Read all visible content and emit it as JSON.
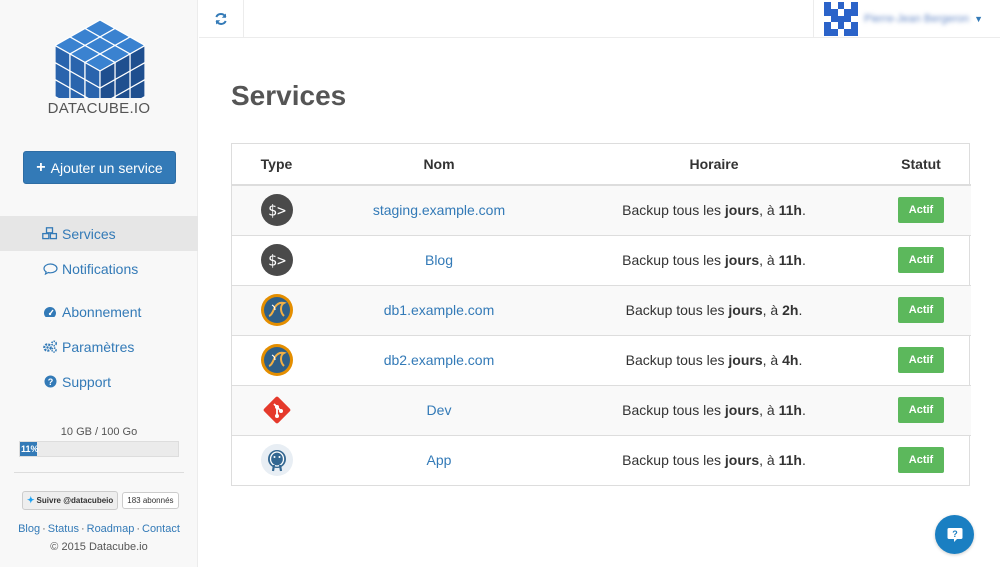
{
  "sidebar": {
    "brand": "DATACUBE.IO",
    "add_button": "Ajouter un service",
    "nav": [
      {
        "label": "Services",
        "icon": "cubes-icon",
        "active": true
      },
      {
        "label": "Notifications",
        "icon": "comment-icon",
        "active": false
      },
      {
        "label": "Abonnement",
        "icon": "tachometer-icon",
        "active": false
      },
      {
        "label": "Paramètres",
        "icon": "cogs-icon",
        "active": false
      },
      {
        "label": "Support",
        "icon": "question-circle-icon",
        "active": false
      }
    ],
    "quota": {
      "label": "10 GB / 100 Go",
      "percent_label": "11%",
      "fraction": 0.11
    },
    "twitter": {
      "follow_label": "Suivre @datacubeio",
      "count_label": "183 abonnés"
    },
    "footer_links": [
      "Blog",
      "Status",
      "Roadmap",
      "Contact"
    ],
    "copyright": "© 2015 Datacube.io"
  },
  "topbar": {
    "refresh_icon": "refresh-icon",
    "user_name": "Pierre-Jean Bergeron"
  },
  "main": {
    "title": "Services",
    "table": {
      "headers": {
        "type": "Type",
        "nom": "Nom",
        "horaire": "Horaire",
        "statut": "Statut"
      },
      "rows": [
        {
          "type": "terminal",
          "nom": "staging.example.com",
          "horaire_prefix": "Backup tous les ",
          "horaire_bold1": "jours",
          "horaire_mid": ", à ",
          "horaire_bold2": "11h",
          "horaire_suffix": ".",
          "statut": "Actif"
        },
        {
          "type": "terminal",
          "nom": "Blog",
          "horaire_prefix": "Backup tous les ",
          "horaire_bold1": "jours",
          "horaire_mid": ", à ",
          "horaire_bold2": "11h",
          "horaire_suffix": ".",
          "statut": "Actif"
        },
        {
          "type": "mysql",
          "nom": "db1.example.com",
          "horaire_prefix": "Backup tous les ",
          "horaire_bold1": "jours",
          "horaire_mid": ", à ",
          "horaire_bold2": "2h",
          "horaire_suffix": ".",
          "statut": "Actif"
        },
        {
          "type": "mysql",
          "nom": "db2.example.com",
          "horaire_prefix": "Backup tous les ",
          "horaire_bold1": "jours",
          "horaire_mid": ", à ",
          "horaire_bold2": "4h",
          "horaire_suffix": ".",
          "statut": "Actif"
        },
        {
          "type": "git",
          "nom": "Dev",
          "horaire_prefix": "Backup tous les ",
          "horaire_bold1": "jours",
          "horaire_mid": ", à ",
          "horaire_bold2": "11h",
          "horaire_suffix": ".",
          "statut": "Actif"
        },
        {
          "type": "postgresql",
          "nom": "App",
          "horaire_prefix": "Backup tous les ",
          "horaire_bold1": "jours",
          "horaire_mid": ", à ",
          "horaire_bold2": "11h",
          "horaire_suffix": ".",
          "statut": "Actif"
        }
      ]
    }
  },
  "help_button": {
    "icon": "help-chat-icon"
  },
  "colors": {
    "primary": "#337ab7",
    "success": "#5cb85c",
    "help": "#1a7fc2",
    "logo": "#2f6fb8"
  }
}
